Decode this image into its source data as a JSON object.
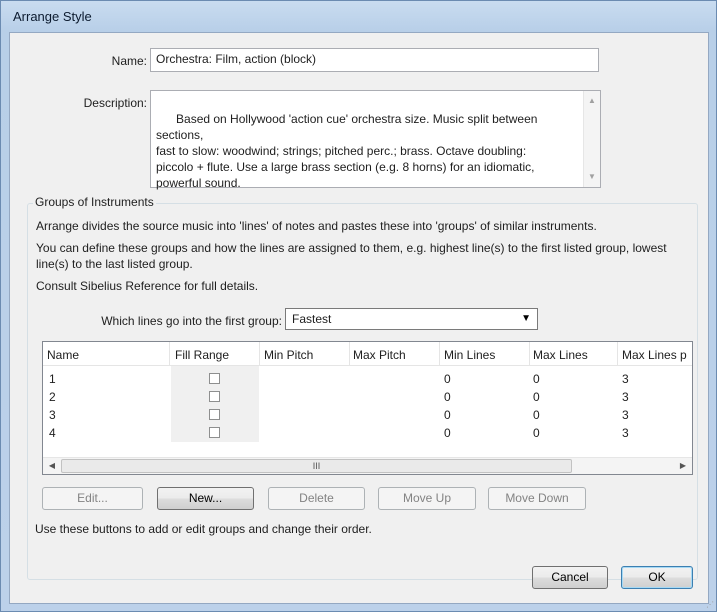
{
  "window": {
    "title": "Arrange Style"
  },
  "form": {
    "name_label": "Name:",
    "name_value": "Orchestra: Film, action (block)",
    "description_label": "Description:",
    "description_value": "Based on Hollywood 'action cue' orchestra size. Music split between sections,\nfast to slow: woodwind; strings; pitched perc.; brass. Octave doubling:\npiccolo + flute. Use a large brass section (e.g. 8 horns) for an idiomatic,\npowerful sound."
  },
  "groups": {
    "legend": "Groups of Instruments",
    "para1": "Arrange divides the source music into 'lines' of notes and pastes these into 'groups' of similar instruments.",
    "para2": "You can define these groups and how the lines are assigned to them, e.g. highest line(s) to the first listed group, lowest line(s) to the last listed group.",
    "para3": "Consult Sibelius Reference for full details.",
    "first_group_label": "Which lines go into the first group:",
    "first_group_value": "Fastest",
    "columns": [
      "Name",
      "Fill Range",
      "Min Pitch",
      "Max Pitch",
      "Min Lines",
      "Max Lines",
      "Max Lines p"
    ],
    "rows": [
      {
        "name": "1",
        "fill_range": false,
        "min_pitch": "",
        "max_pitch": "",
        "min_lines": "0",
        "max_lines": "0",
        "max_lines_p": "3"
      },
      {
        "name": "2",
        "fill_range": false,
        "min_pitch": "",
        "max_pitch": "",
        "min_lines": "0",
        "max_lines": "0",
        "max_lines_p": "3"
      },
      {
        "name": "3",
        "fill_range": false,
        "min_pitch": "",
        "max_pitch": "",
        "min_lines": "0",
        "max_lines": "0",
        "max_lines_p": "3"
      },
      {
        "name": "4",
        "fill_range": false,
        "min_pitch": "",
        "max_pitch": "",
        "min_lines": "0",
        "max_lines": "0",
        "max_lines_p": "3"
      }
    ],
    "scroll_grip": "III",
    "buttons": {
      "edit": "Edit...",
      "new": "New...",
      "delete": "Delete",
      "move_up": "Move Up",
      "move_down": "Move Down"
    },
    "hint": "Use these buttons to add or edit groups and change their order."
  },
  "footer": {
    "cancel": "Cancel",
    "ok": "OK"
  },
  "icons": {
    "scroll_up": "scroll-up-arrow-icon",
    "scroll_down": "scroll-down-arrow-icon",
    "scroll_left": "scroll-left-arrow-icon",
    "scroll_right": "scroll-right-arrow-icon",
    "dropdown": "chevron-down-icon"
  },
  "colors": {
    "titlebar": "#bcd1ea",
    "dialog_bg": "#f0f0f0",
    "default_button_border": "#3c7fb1"
  }
}
